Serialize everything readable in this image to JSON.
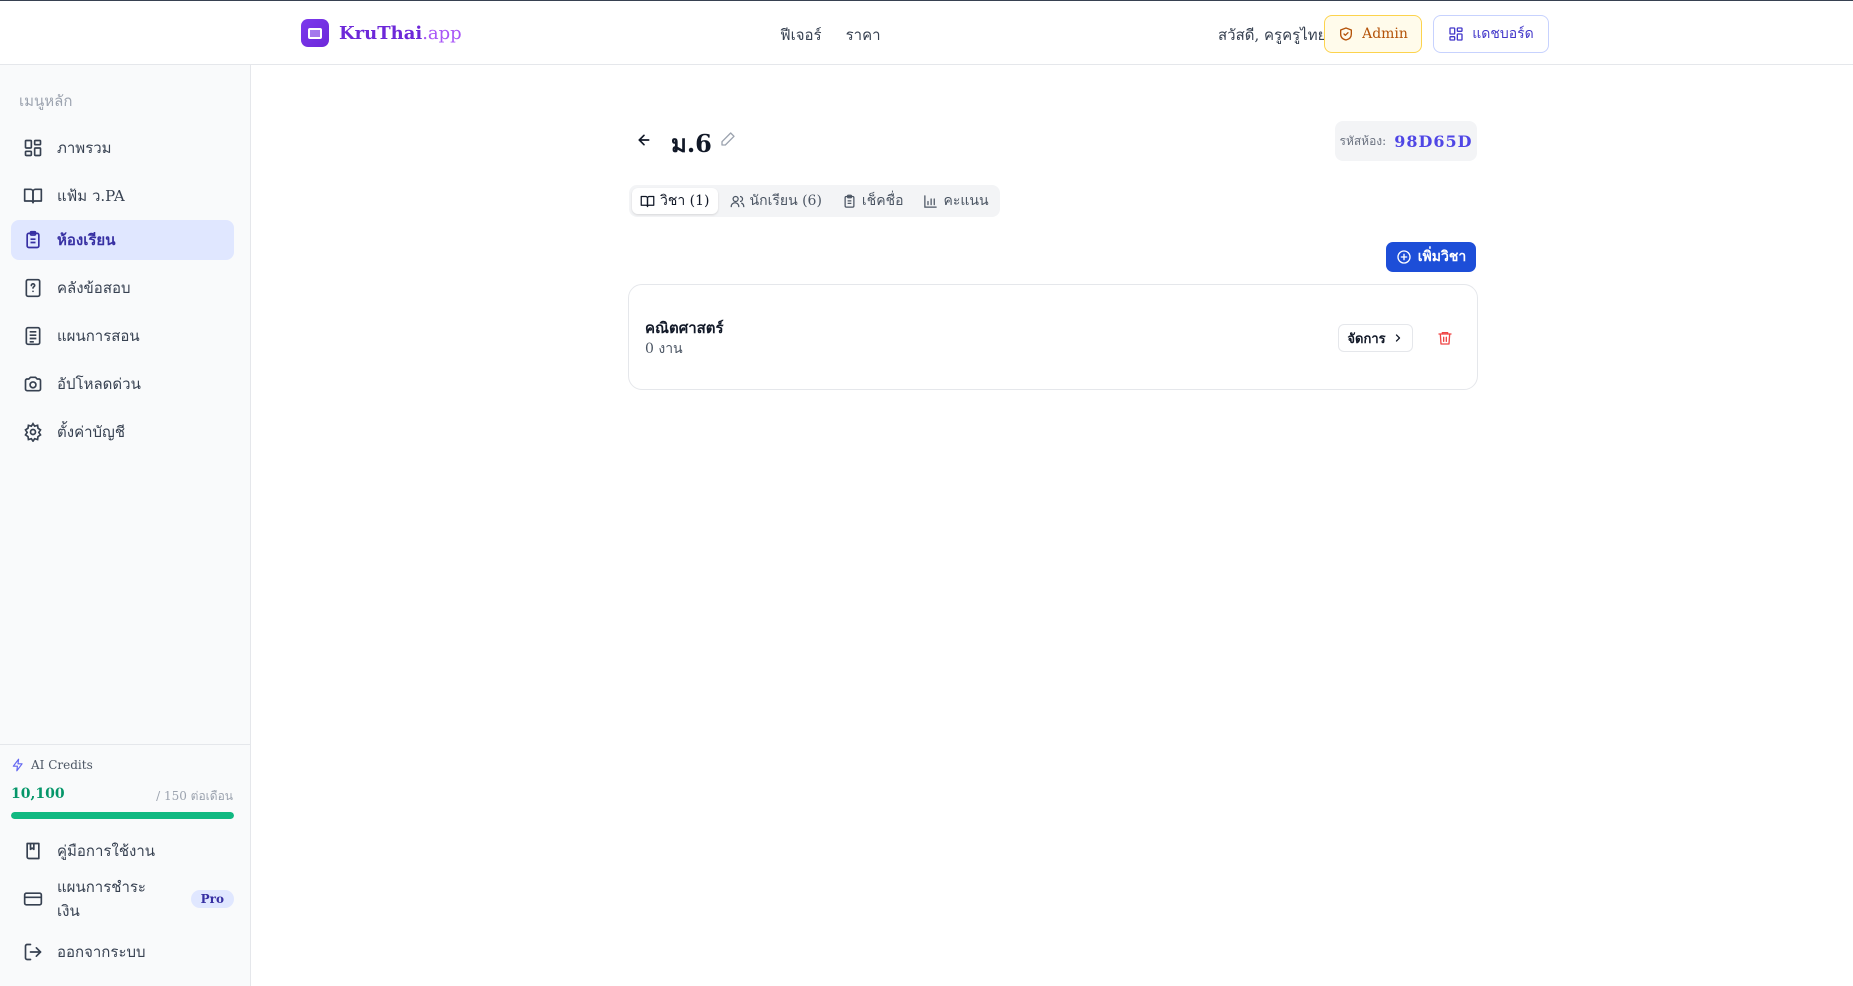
{
  "header": {
    "brand_name": "KruThai",
    "brand_suffix": ".app",
    "nav": [
      "ฟีเจอร์",
      "ราคา"
    ],
    "greeting": "สวัสดี, ครูครูไทย",
    "admin_label": "Admin",
    "dashboard_label": "แดชบอร์ด"
  },
  "sidebar": {
    "heading": "เมนูหลัก",
    "items": [
      {
        "label": "ภาพรวม",
        "icon": "grid-icon"
      },
      {
        "label": "แฟ้ม ว.PA",
        "icon": "book-open-icon"
      },
      {
        "label": "ห้องเรียน",
        "icon": "clipboard-icon",
        "active": true
      },
      {
        "label": "คลังข้อสอบ",
        "icon": "question-file-icon"
      },
      {
        "label": "แผนการสอน",
        "icon": "document-icon"
      },
      {
        "label": "อัปโหลดด่วน",
        "icon": "camera-icon"
      },
      {
        "label": "ตั้งค่าบัญชี",
        "icon": "gear-icon"
      }
    ],
    "credits": {
      "label": "AI Credits",
      "value": "10,100",
      "limit": "/ 150 ต่อเดือน",
      "fill_fraction": 1.0,
      "color": "#10b981"
    },
    "bottom_items": [
      {
        "label": "คู่มือการใช้งาน",
        "icon": "bookmark-book-icon"
      },
      {
        "label": "แผนการชำระเงิน",
        "icon": "credit-card-icon",
        "badge": "Pro"
      },
      {
        "label": "ออกจากระบบ",
        "icon": "logout-icon"
      }
    ]
  },
  "room": {
    "title": "ม.6",
    "code_label": "รหัสห้อง:",
    "code_value": "98D65D"
  },
  "tabs": [
    {
      "label": "วิชา (1)",
      "icon": "book-open-icon",
      "active": true
    },
    {
      "label": "นักเรียน (6)",
      "icon": "users-icon"
    },
    {
      "label": "เช็คชื่อ",
      "icon": "clipboard-check-icon"
    },
    {
      "label": "คะแนน",
      "icon": "bar-chart-icon"
    }
  ],
  "add_subject_label": "เพิ่มวิชา",
  "subjects": [
    {
      "name": "คณิตศาสตร์",
      "meta": "0 งาน",
      "manage_label": "จัดการ"
    }
  ],
  "colors": {
    "accent": "#1d4ed8",
    "brand": "#6d28d9",
    "active_nav_bg": "#e0e7ff",
    "danger": "#ef4444"
  }
}
